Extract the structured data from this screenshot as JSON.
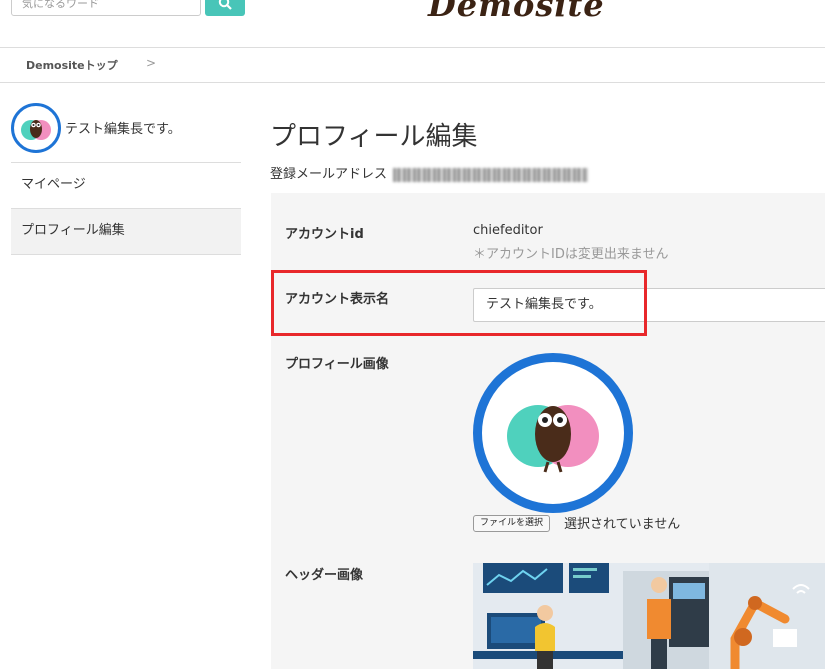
{
  "header": {
    "search_placeholder": "気になるワード",
    "logo_text": "Demosite"
  },
  "breadcrumb": {
    "home": "Demositeトップ",
    "separator": ">"
  },
  "sidebar": {
    "user_name": "テスト編集長です。",
    "items": [
      {
        "label": "マイページ"
      },
      {
        "label": "プロフィール編集"
      }
    ]
  },
  "main": {
    "title": "プロフィール編集",
    "email_label": "登録メールアドレス",
    "fields": {
      "account_id_label": "アカウントid",
      "account_id_value": "chiefeditor",
      "account_id_note": "＊アカウントIDは変更出来ません",
      "display_name_label": "アカウント表示名",
      "display_name_value": "テスト編集長です。",
      "profile_image_label": "プロフィール画像",
      "file_button": "ファイルを選択",
      "file_status": "選択されていません",
      "header_image_label": "ヘッダー画像"
    }
  },
  "colors": {
    "accent": "#48c5b8",
    "avatar_border": "#1e74d6",
    "highlight": "#e8282b"
  }
}
